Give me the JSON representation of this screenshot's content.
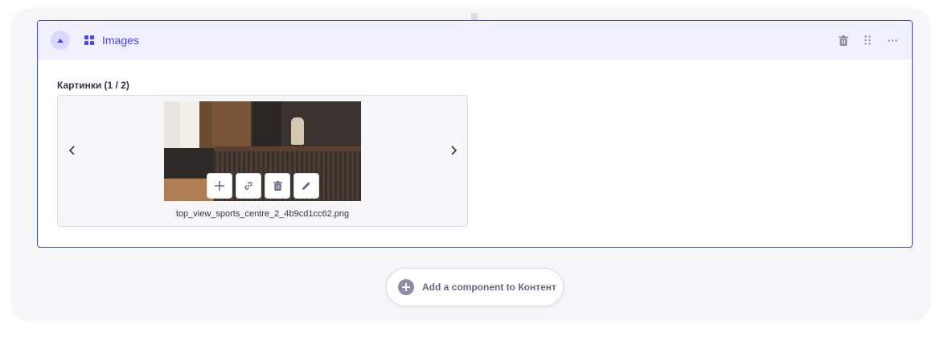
{
  "component": {
    "title": "Images",
    "icons": {
      "collapse": "chevron-up-icon",
      "type": "grid-icon",
      "delete": "trash-icon",
      "drag": "drag-handle-icon",
      "more": "more-icon"
    }
  },
  "field": {
    "label": "Картинки (1 / 2)"
  },
  "carousel": {
    "filename": "top_view_sports_centre_2_4b9cd1cc62.png",
    "actions": [
      "add-icon",
      "link-icon",
      "trash-icon",
      "edit-icon"
    ]
  },
  "add_component": {
    "label": "Add a component to Контент"
  },
  "colors": {
    "accent": "#4945ff",
    "header_bg": "#f0f0ff",
    "text": "#32324d"
  }
}
